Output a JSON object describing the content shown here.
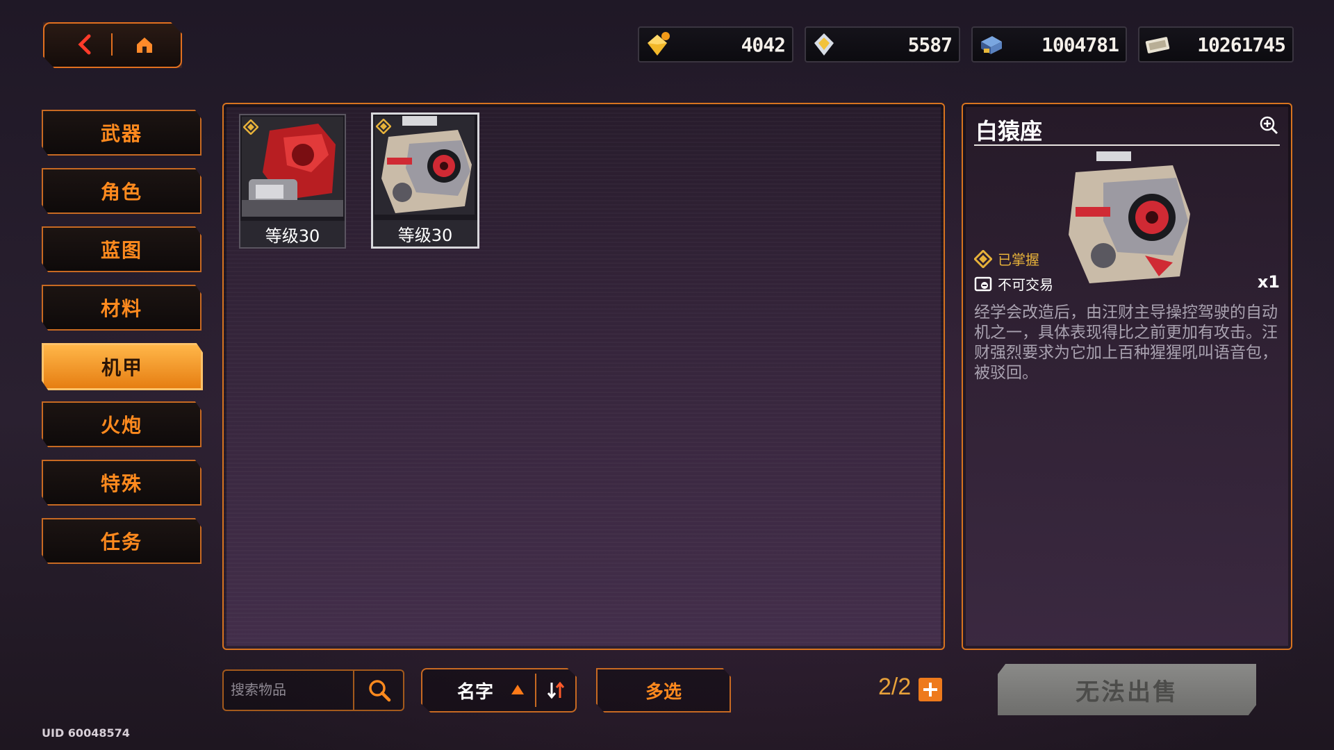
{
  "currencies": [
    {
      "icon": "gold-gem-icon",
      "value": "4042"
    },
    {
      "icon": "silver-gem-icon",
      "value": "5587"
    },
    {
      "icon": "coin-stack-icon",
      "value": "1004781"
    },
    {
      "icon": "banknote-icon",
      "value": "10261745"
    }
  ],
  "sidebar": {
    "items": [
      {
        "label": "武器",
        "active": false
      },
      {
        "label": "角色",
        "active": false
      },
      {
        "label": "蓝图",
        "active": false
      },
      {
        "label": "材料",
        "active": false
      },
      {
        "label": "机甲",
        "active": true
      },
      {
        "label": "火炮",
        "active": false
      },
      {
        "label": "特殊",
        "active": false
      },
      {
        "label": "任务",
        "active": false
      }
    ]
  },
  "inventory": {
    "items": [
      {
        "level": "等级30",
        "selected": false
      },
      {
        "level": "等级30",
        "selected": true
      }
    ]
  },
  "detail": {
    "title": "白猿座",
    "status": "已掌握",
    "trade": "不可交易",
    "quantity": "x1",
    "description": "经学会改造后，由汪财主导操控驾驶的自动机之一，具体表现得比之前更加有攻击。汪财强烈要求为它加上百种猩猩吼叫语音包，被驳回。"
  },
  "bottom": {
    "search_placeholder": "搜索物品",
    "sort_label": "名字",
    "multi_select": "多选",
    "count": "2/2",
    "sell_button": "无法出售"
  },
  "uid": "UID 60048574",
  "colors": {
    "accent": "#ff8a1e",
    "panel_border": "#d8741f",
    "status_gold": "#e7b23a"
  }
}
